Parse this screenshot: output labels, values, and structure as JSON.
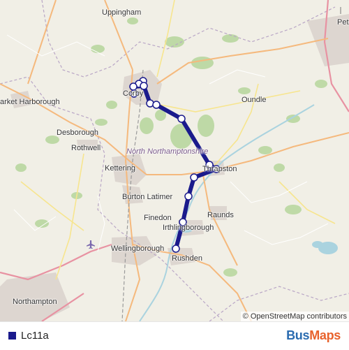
{
  "map": {
    "places": [
      {
        "name": "Uppingham",
        "kind": "town"
      },
      {
        "name": "Pet",
        "kind": "town"
      },
      {
        "name": "Corby",
        "kind": "town"
      },
      {
        "name": "arket Harborough",
        "kind": "town"
      },
      {
        "name": "Oundle",
        "kind": "town"
      },
      {
        "name": "Desborough",
        "kind": "town"
      },
      {
        "name": "Rothwell",
        "kind": "town"
      },
      {
        "name": "North Northamptonshire",
        "kind": "area"
      },
      {
        "name": "Kettering",
        "kind": "town"
      },
      {
        "name": "Thrapston",
        "kind": "town"
      },
      {
        "name": "Burton Latimer",
        "kind": "town"
      },
      {
        "name": "Raunds",
        "kind": "town"
      },
      {
        "name": "Finedon",
        "kind": "town"
      },
      {
        "name": "Irthlingborough",
        "kind": "town"
      },
      {
        "name": "Wellingborough",
        "kind": "town"
      },
      {
        "name": "Rushden",
        "kind": "town"
      },
      {
        "name": "Northampton",
        "kind": "town"
      }
    ],
    "route_color": "#1a1a8c",
    "stop_count": 14,
    "attribution": {
      "prefix": "©",
      "text": "OpenStreetMap contributors"
    },
    "airport_icon": "airplane-icon"
  },
  "legend": {
    "route_name": "Lc11a",
    "route_color": "#1a1a8c"
  },
  "brand": {
    "part1": "Bus",
    "part2": "Maps",
    "color1": "#2b6cb0",
    "color2": "#e8622c"
  }
}
